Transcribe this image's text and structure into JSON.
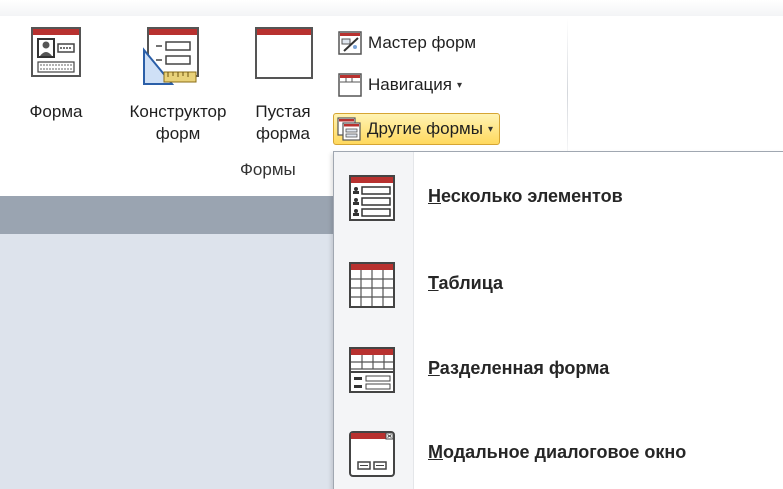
{
  "ribbon": {
    "buttons": {
      "form": {
        "label": "Форма"
      },
      "designer": {
        "label_line1": "Конструктор",
        "label_line2": "форм"
      },
      "blank": {
        "label_line1": "Пустая",
        "label_line2": "форма"
      }
    },
    "small_buttons": {
      "wizard": {
        "label": "Мастер форм",
        "icon": "form-wizard-icon"
      },
      "navigation": {
        "label": "Навигация",
        "icon": "navigation-form-icon",
        "arrow": "▾"
      },
      "other_forms": {
        "label": "Другие формы",
        "icon": "other-forms-icon",
        "arrow": "▾"
      }
    },
    "group_label": "Формы"
  },
  "menu": {
    "items": [
      {
        "accel": "Н",
        "rest": "есколько элементов",
        "icon": "multiple-items-icon"
      },
      {
        "accel": "Т",
        "rest": "аблица",
        "icon": "datasheet-icon"
      },
      {
        "accel": "Р",
        "rest": "азделенная форма",
        "icon": "split-form-icon"
      },
      {
        "accel": "М",
        "rest": "одальное диалоговое окно",
        "icon": "modal-dialog-icon"
      }
    ]
  },
  "colors": {
    "accent_header": "#b8312f",
    "active_button_top": "#fff3b3",
    "active_button_bottom": "#ffd95e",
    "gray_bar": "#9aa4b1",
    "workspace": "#dde3ec"
  }
}
